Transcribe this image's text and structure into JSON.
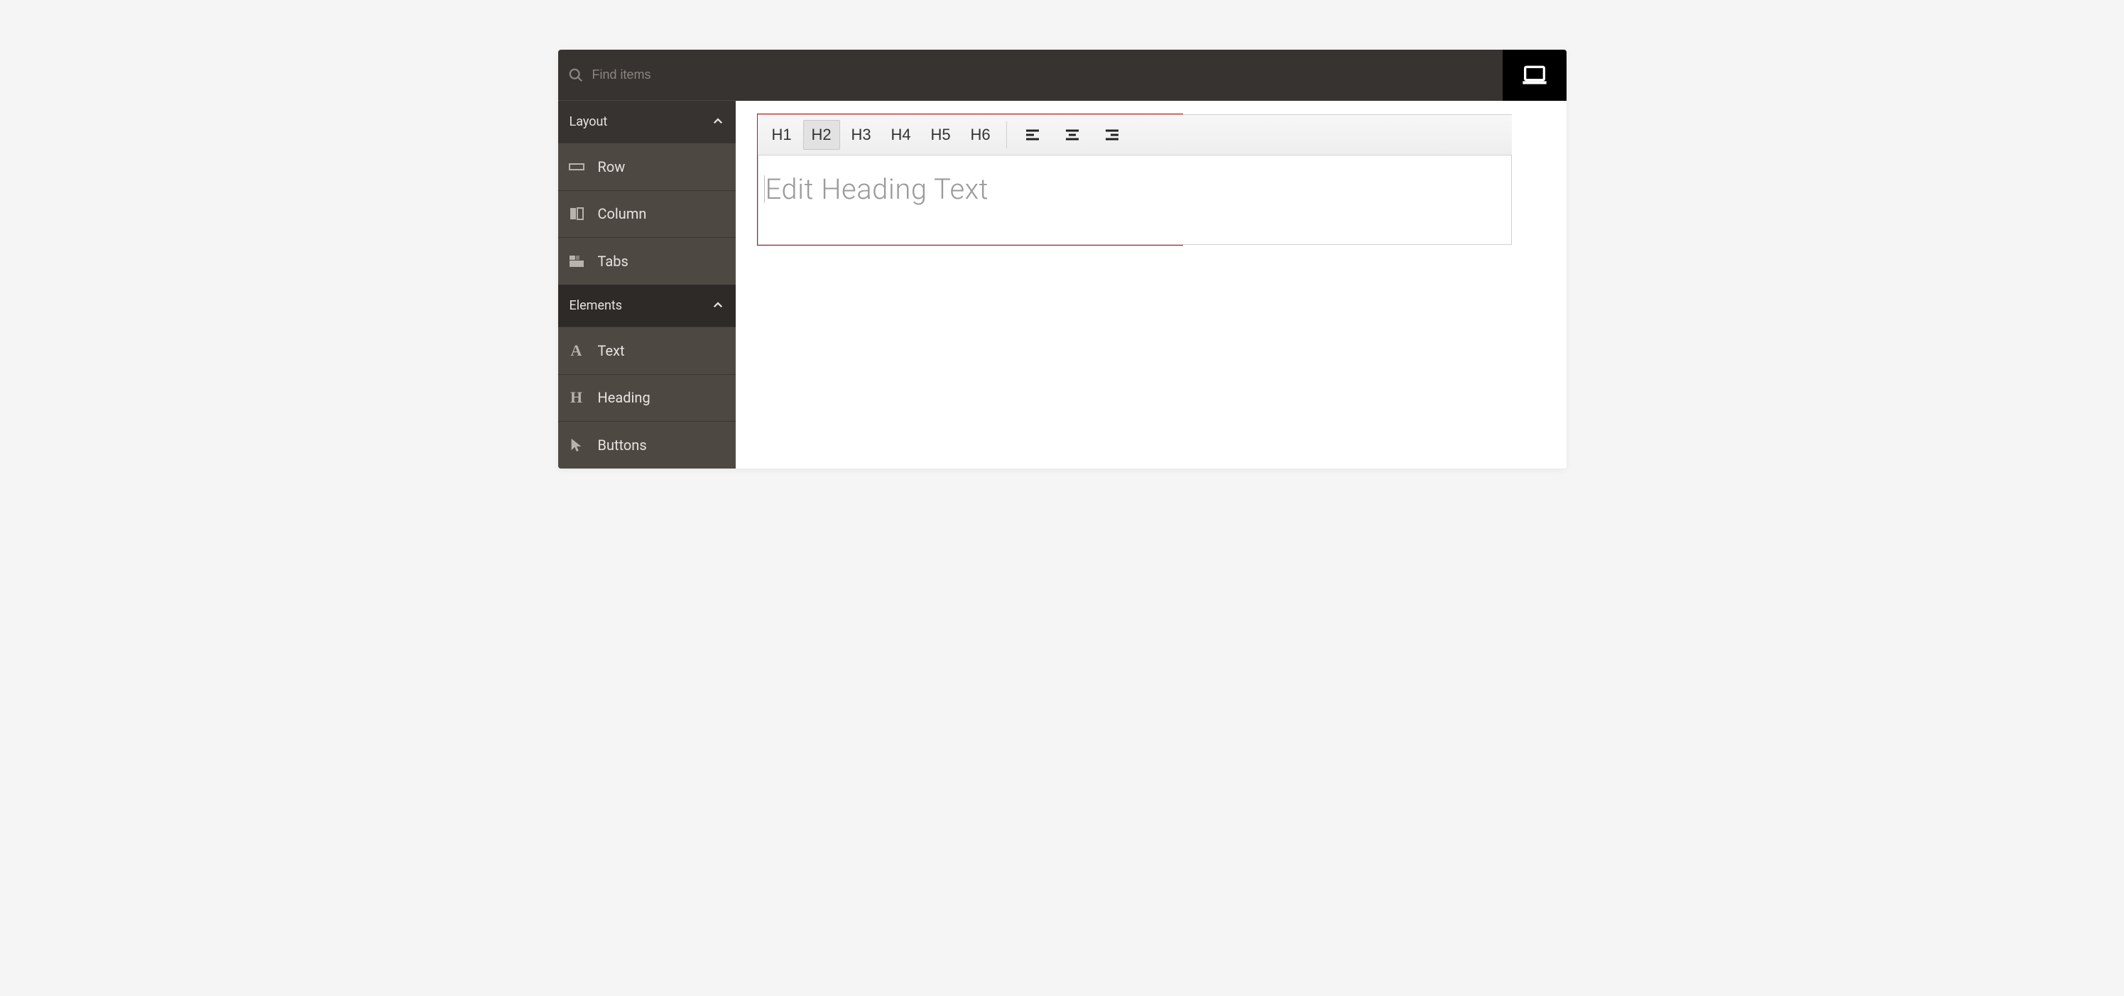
{
  "search": {
    "placeholder": "Find items"
  },
  "sidebar": {
    "sections": [
      {
        "label": "Layout",
        "items": [
          {
            "label": "Row"
          },
          {
            "label": "Column"
          },
          {
            "label": "Tabs"
          }
        ]
      },
      {
        "label": "Elements",
        "items": [
          {
            "label": "Text"
          },
          {
            "label": "Heading"
          },
          {
            "label": "Buttons"
          }
        ]
      }
    ]
  },
  "toolbar": {
    "headings": [
      "H1",
      "H2",
      "H3",
      "H4",
      "H5",
      "H6"
    ],
    "active_heading": "H2"
  },
  "editor": {
    "placeholder": "Edit Heading Text"
  }
}
